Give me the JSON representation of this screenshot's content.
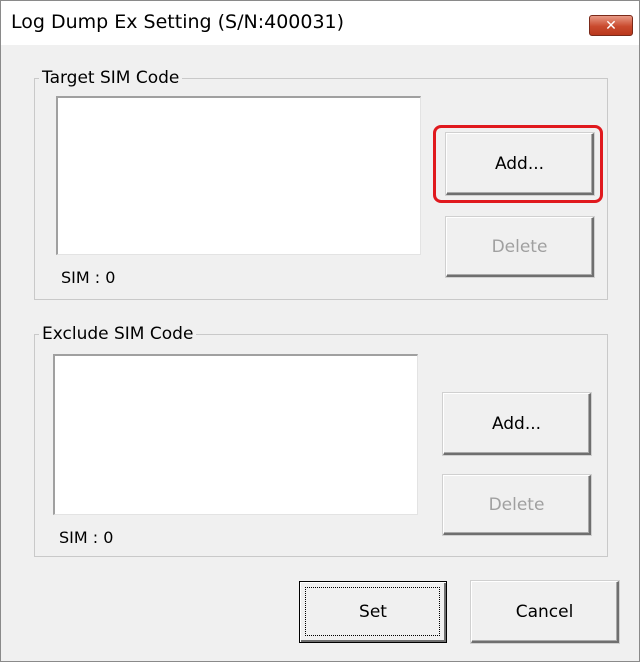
{
  "window": {
    "title": "Log Dump Ex Setting (S/N:400031)",
    "close_glyph": "✕"
  },
  "target_group": {
    "label": "Target SIM Code",
    "add_label": "Add...",
    "delete_label": "Delete",
    "count_text": "SIM : 0"
  },
  "exclude_group": {
    "label": "Exclude SIM Code",
    "add_label": "Add...",
    "delete_label": "Delete",
    "count_text": "SIM : 0"
  },
  "footer": {
    "set_label": "Set",
    "cancel_label": "Cancel"
  },
  "colors": {
    "highlight": "#e0191e",
    "close_button": "#c94a2e"
  }
}
